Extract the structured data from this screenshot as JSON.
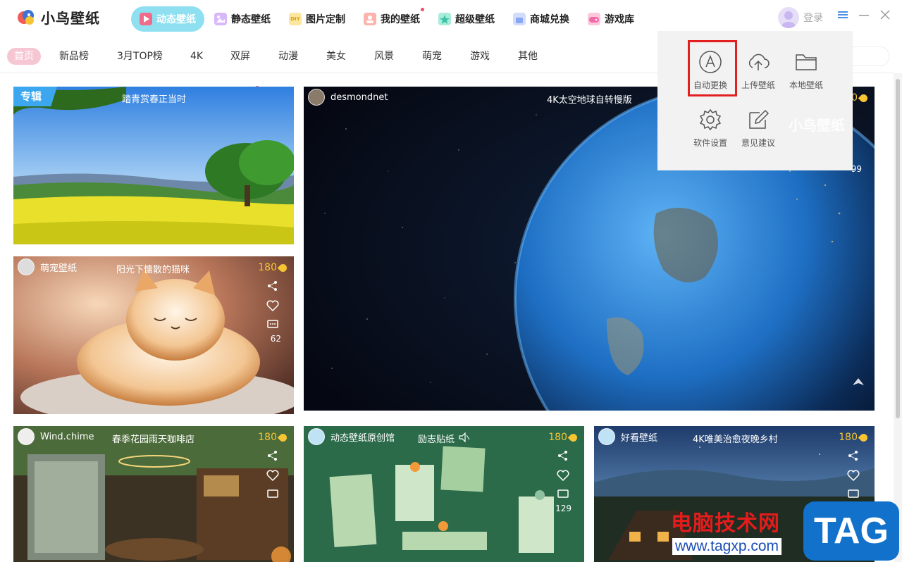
{
  "app": {
    "name": "小鸟壁纸"
  },
  "nav": [
    {
      "label": "动态壁纸",
      "icon": "play-icon",
      "color": "#f06a8a",
      "active": true
    },
    {
      "label": "静态壁纸",
      "icon": "image-icon",
      "color": "#c18df5"
    },
    {
      "label": "图片定制",
      "icon": "diy-icon",
      "color": "#f7c531",
      "badge": "DIY"
    },
    {
      "label": "我的壁纸",
      "icon": "user-icon",
      "color": "#f57a6a",
      "dot": true
    },
    {
      "label": "超级壁纸",
      "icon": "star-icon",
      "color": "#3cc3a7"
    },
    {
      "label": "商城兑换",
      "icon": "bag-icon",
      "color": "#8aa7f5"
    },
    {
      "label": "游戏库",
      "icon": "gamepad-icon",
      "color": "#f06aa8"
    }
  ],
  "user": {
    "login": "登录"
  },
  "categories": [
    "首页",
    "新品榜",
    "3月TOP榜",
    "4K",
    "双屏",
    "动漫",
    "美女",
    "风景",
    "萌宠",
    "游戏",
    "其他"
  ],
  "cards": {
    "spring": {
      "tag": "专辑",
      "title": "踏青赏春正当时"
    },
    "earth": {
      "author": "desmondnet",
      "title": "4K太空地球自转慢版",
      "price": "240",
      "comments": "99"
    },
    "cat": {
      "author": "萌宠壁纸",
      "title": "阳光下慵散的猫咪",
      "price": "180",
      "comments": "62"
    },
    "cafe": {
      "author": "Wind.chime",
      "title": "春季花园雨天咖啡店",
      "price": "180"
    },
    "notes": {
      "author": "动态壁纸原创馆",
      "title": "励志贴纸",
      "price": "180",
      "comments": "129"
    },
    "village": {
      "author": "好看壁纸",
      "title": "4K唯美治愈夜晚乡村",
      "price": "180"
    }
  },
  "dropdown": {
    "items": [
      {
        "label": "自动更换",
        "icon": "auto-change-icon"
      },
      {
        "label": "上传壁纸",
        "icon": "cloud-upload-icon"
      },
      {
        "label": "本地壁纸",
        "icon": "folder-icon"
      },
      {
        "label": "软件设置",
        "icon": "gear-icon"
      },
      {
        "label": "意见建议",
        "icon": "edit-icon"
      }
    ]
  },
  "watermark": {
    "text": "电脑技术网",
    "url": "www.tagxp.com",
    "tag": "TAG"
  },
  "overlay_brand": "小鸟壁纸"
}
